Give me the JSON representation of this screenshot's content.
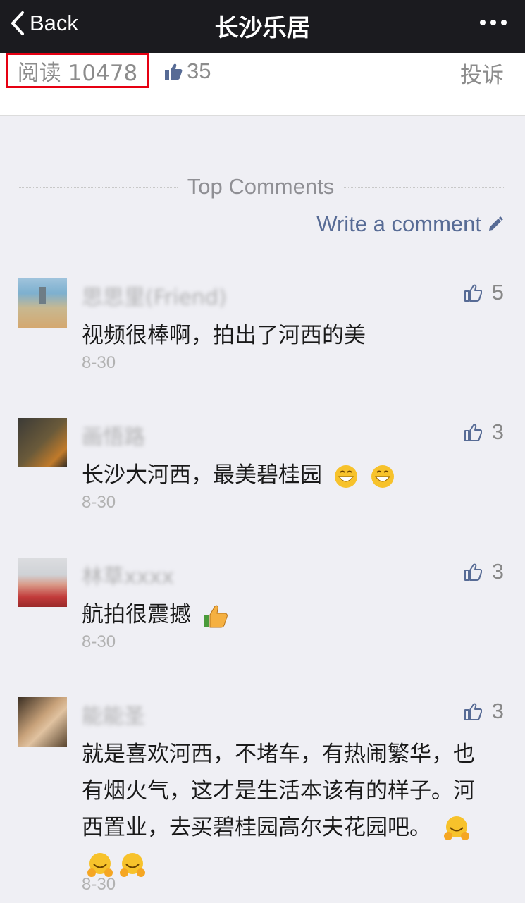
{
  "navbar": {
    "back_label": "Back",
    "title": "长沙乐居"
  },
  "stats": {
    "reads": "阅读 10478",
    "likes": "35",
    "report": "投诉"
  },
  "section": {
    "title": "Top Comments",
    "write_label": "Write a comment"
  },
  "comments": [
    {
      "name": "思思里(Friend)",
      "likes": "5",
      "text": "视频很棒啊，拍出了河西的美",
      "date": "8-30"
    },
    {
      "name": "画悟路",
      "likes": "3",
      "text": "长沙大河西，最美碧桂园",
      "date": "8-30"
    },
    {
      "name": "林草xxxx",
      "likes": "3",
      "text": "航拍很震撼",
      "date": "8-30"
    },
    {
      "name": "能能圣",
      "likes": "3",
      "text": "就是喜欢河西，不堵车，有热闹繁华，也有烟火气，这才是生活本该有的样子。河西置业，去买碧桂园高尔夫花园吧。",
      "date": "8-30"
    }
  ],
  "colors": {
    "accent": "#576b95",
    "highlight": "#e60012",
    "navbar": "#1b1b1f"
  }
}
